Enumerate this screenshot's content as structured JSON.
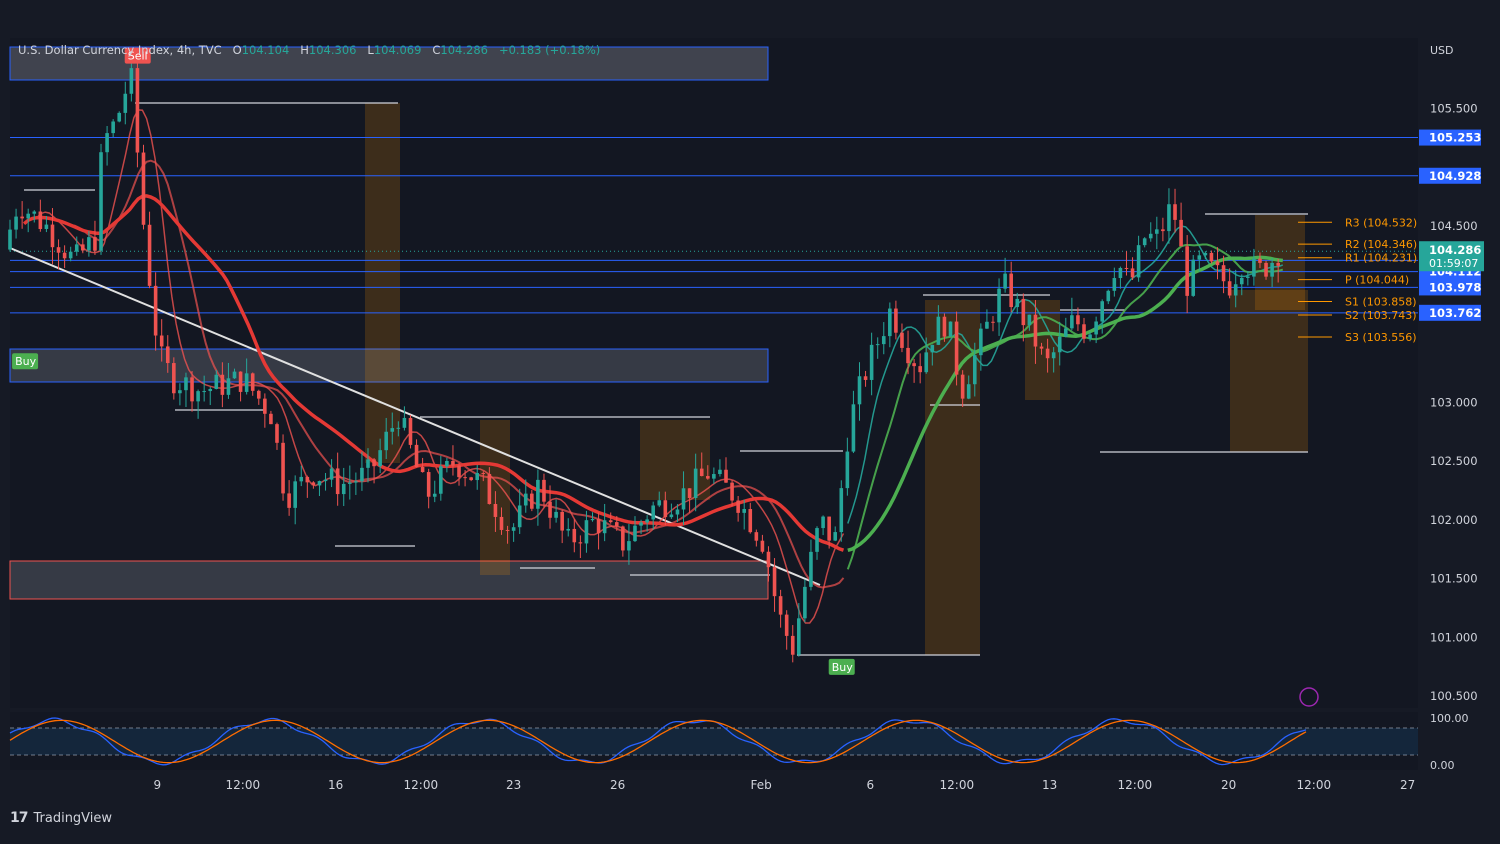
{
  "header": {
    "symbol": "U.S. Dollar Currency Index, 4h, TVC",
    "o_label": "O",
    "o_value": "104.104",
    "h_label": "H",
    "h_value": "104.306",
    "l_label": "L",
    "l_value": "104.069",
    "c_label": "C",
    "c_value": "104.286",
    "change": "+0.183 (+0.18%)"
  },
  "currency": "USD",
  "brand": "TradingView",
  "colors": {
    "background": "#161a25",
    "up": "#26a69a",
    "down": "#ef5350",
    "hline": "#2962ff",
    "pivot": "#ff9800"
  },
  "chart_data": {
    "type": "candlestick",
    "title": "U.S. Dollar Currency Index, 4h, TVC",
    "ylim": [
      100.4,
      106.1
    ],
    "y_ticks": [
      "105.500",
      "104.500",
      "103.000",
      "102.500",
      "102.000",
      "101.500",
      "101.000",
      "100.500"
    ],
    "x_ticks": [
      "9",
      "12:00",
      "16",
      "12:00",
      "23",
      "26",
      "Feb",
      "6",
      "12:00",
      "13",
      "12:00",
      "20",
      "12:00",
      "27"
    ],
    "last": {
      "price": "104.286",
      "countdown": "01:59:07"
    },
    "price_badges": [
      {
        "label": "105.253",
        "value": 105.253
      },
      {
        "label": "104.928",
        "value": 104.928
      },
      {
        "label": "104.208",
        "value": 104.208
      },
      {
        "label": "104.112",
        "value": 104.112
      },
      {
        "label": "103.978",
        "value": 103.978
      },
      {
        "label": "103.762",
        "value": 103.762
      }
    ],
    "pivots": [
      {
        "label": "R3 (104.532)",
        "value": 104.532
      },
      {
        "label": "R2 (104.346)",
        "value": 104.346
      },
      {
        "label": "R1 (104.231)",
        "value": 104.231
      },
      {
        "label": "P (104.044)",
        "value": 104.044
      },
      {
        "label": "S1 (103.858)",
        "value": 103.858
      },
      {
        "label": "S2 (103.743)",
        "value": 103.743
      },
      {
        "label": "S3 (103.556)",
        "value": 103.556
      }
    ],
    "signals": [
      {
        "label": "Sell",
        "x": 0.09,
        "price": 105.95
      },
      {
        "label": "Buy",
        "x": 0.01,
        "price": 103.35
      },
      {
        "label": "Buy",
        "x": 0.59,
        "price": 100.75
      }
    ],
    "price_path": [
      [
        0.0,
        104.3
      ],
      [
        0.01,
        104.7
      ],
      [
        0.03,
        104.5
      ],
      [
        0.05,
        104.2
      ],
      [
        0.065,
        104.4
      ],
      [
        0.07,
        105.2
      ],
      [
        0.08,
        105.4
      ],
      [
        0.09,
        105.8
      ],
      [
        0.1,
        104.4
      ],
      [
        0.11,
        103.4
      ],
      [
        0.12,
        103.2
      ],
      [
        0.14,
        103.1
      ],
      [
        0.17,
        103.2
      ],
      [
        0.19,
        102.9
      ],
      [
        0.2,
        102.2
      ],
      [
        0.22,
        102.4
      ],
      [
        0.24,
        102.3
      ],
      [
        0.26,
        102.4
      ],
      [
        0.28,
        102.9
      ],
      [
        0.3,
        102.2
      ],
      [
        0.32,
        102.5
      ],
      [
        0.34,
        102.3
      ],
      [
        0.36,
        101.9
      ],
      [
        0.38,
        102.3
      ],
      [
        0.4,
        101.8
      ],
      [
        0.42,
        102.0
      ],
      [
        0.44,
        101.8
      ],
      [
        0.46,
        102.1
      ],
      [
        0.48,
        102.2
      ],
      [
        0.5,
        102.4
      ],
      [
        0.52,
        102.2
      ],
      [
        0.54,
        101.8
      ],
      [
        0.55,
        101.2
      ],
      [
        0.56,
        100.9
      ],
      [
        0.57,
        101.5
      ],
      [
        0.58,
        102.0
      ],
      [
        0.59,
        101.8
      ],
      [
        0.6,
        102.8
      ],
      [
        0.61,
        103.2
      ],
      [
        0.62,
        103.5
      ],
      [
        0.63,
        103.8
      ],
      [
        0.64,
        103.5
      ],
      [
        0.65,
        103.3
      ],
      [
        0.66,
        103.6
      ],
      [
        0.67,
        103.7
      ],
      [
        0.68,
        103.1
      ],
      [
        0.69,
        103.4
      ],
      [
        0.7,
        103.7
      ],
      [
        0.71,
        104.0
      ],
      [
        0.72,
        103.8
      ],
      [
        0.73,
        103.6
      ],
      [
        0.74,
        103.3
      ],
      [
        0.75,
        103.5
      ],
      [
        0.76,
        103.7
      ],
      [
        0.77,
        103.6
      ],
      [
        0.78,
        103.9
      ],
      [
        0.79,
        104.2
      ],
      [
        0.8,
        104.0
      ],
      [
        0.81,
        104.4
      ],
      [
        0.82,
        104.4
      ],
      [
        0.83,
        104.7
      ],
      [
        0.84,
        104.0
      ],
      [
        0.85,
        104.2
      ],
      [
        0.86,
        104.1
      ],
      [
        0.87,
        104.0
      ],
      [
        0.88,
        104.2
      ],
      [
        0.89,
        104.1
      ],
      [
        0.9,
        104.2
      ],
      [
        0.905,
        104.286
      ]
    ],
    "stochastic": {
      "levels": [
        "100.00",
        "0.00"
      ]
    }
  }
}
